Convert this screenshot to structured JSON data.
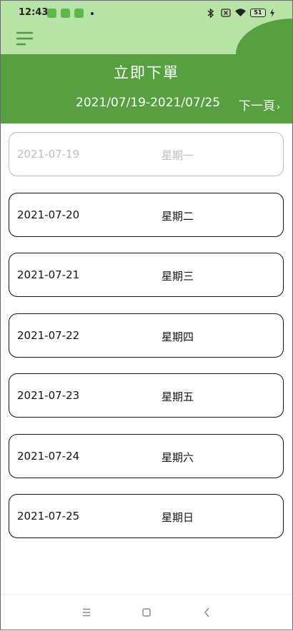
{
  "status_bar": {
    "time": "12:43",
    "battery": "51"
  },
  "header": {
    "title": "立即下單",
    "date_range": "2021/07/19-2021/07/25",
    "next_page_label": "下一頁"
  },
  "days": [
    {
      "date": "2021-07-19",
      "weekday": "星期一",
      "disabled": true
    },
    {
      "date": "2021-07-20",
      "weekday": "星期二",
      "disabled": false
    },
    {
      "date": "2021-07-21",
      "weekday": "星期三",
      "disabled": false
    },
    {
      "date": "2021-07-22",
      "weekday": "星期四",
      "disabled": false
    },
    {
      "date": "2021-07-23",
      "weekday": "星期五",
      "disabled": false
    },
    {
      "date": "2021-07-24",
      "weekday": "星期六",
      "disabled": false
    },
    {
      "date": "2021-07-25",
      "weekday": "星期日",
      "disabled": false
    }
  ],
  "icons": {
    "menu": "menu-icon",
    "bell": "bell-icon",
    "next": "chevron-right-icon",
    "nav_recents": "recents-icon",
    "nav_home": "home-icon",
    "nav_back": "back-icon"
  },
  "colors": {
    "header_light": "#b8e3a6",
    "header_dark": "#56a03f",
    "icon_green": "#4f9a3b",
    "disabled_gray": "#bcbcbc"
  }
}
